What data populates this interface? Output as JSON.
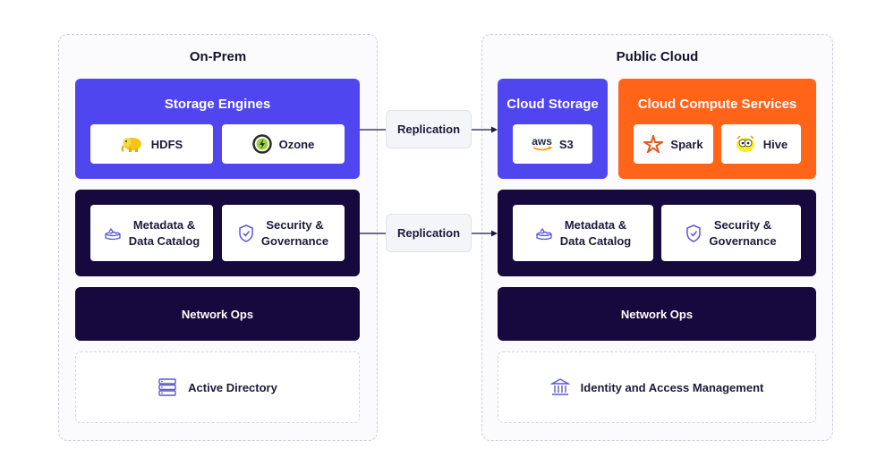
{
  "onprem": {
    "title": "On-Prem",
    "storage": {
      "title": "Storage Engines",
      "hdfs": "HDFS",
      "ozone": "Ozone"
    },
    "metadata": {
      "line1": "Metadata &",
      "line2": "Data Catalog"
    },
    "security": {
      "line1": "Security &",
      "line2": "Governance"
    },
    "network": "Network Ops",
    "directory": "Active Directory"
  },
  "cloud": {
    "title": "Public Cloud",
    "storage": {
      "title": "Cloud Storage",
      "aws": "aws",
      "s3": "S3"
    },
    "compute": {
      "title": "Cloud Compute Services",
      "spark": "Spark",
      "hive": "Hive"
    },
    "metadata": {
      "line1": "Metadata &",
      "line2": "Data Catalog"
    },
    "security": {
      "line1": "Security &",
      "line2": "Governance"
    },
    "network": "Network Ops",
    "iam": "Identity and Access Management"
  },
  "replication": {
    "top": "Replication",
    "middle": "Replication"
  },
  "colors": {
    "purple": "#5046f0",
    "navy": "#16093d",
    "orange": "#ff6419",
    "connector": "#1c1b3a"
  },
  "icons": [
    "hadoop-elephant-icon",
    "ozone-icon",
    "aws-logo-icon",
    "spark-icon",
    "hive-icon",
    "metadata-icon",
    "shield-icon",
    "server-icon",
    "bank-icon",
    "arrow-right-icon"
  ]
}
